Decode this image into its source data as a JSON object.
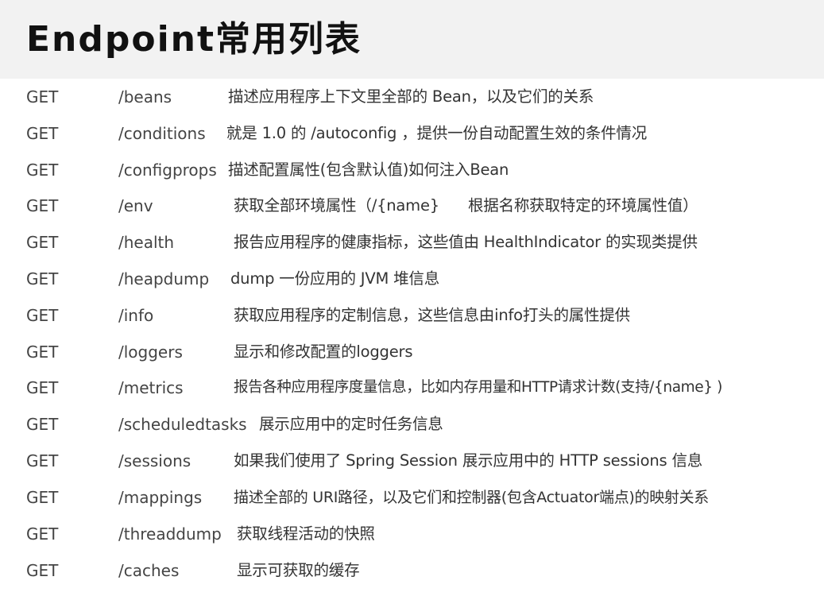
{
  "header": {
    "title": "Endpoint常用列表"
  },
  "endpoints": [
    {
      "method": "GET",
      "path": "/beans",
      "description": "描述应用程序上下文里全部的 Bean，以及它们的关系"
    },
    {
      "method": "GET",
      "path": "/conditions",
      "description": "就是 1.0 的 /autoconfig ，提供一份自动配置生效的条件情况"
    },
    {
      "method": "GET",
      "path": "/configprops",
      "description": "描述配置属性(包含默认值)如何注入Bean"
    },
    {
      "method": "GET",
      "path": "/env",
      "description": "获取全部环境属性（/{name}      根据名称获取特定的环境属性值）"
    },
    {
      "method": "GET",
      "path": "/health",
      "description": "报告应用程序的健康指标，这些值由 HealthIndicator 的实现类提供"
    },
    {
      "method": "GET",
      "path": "/heapdump",
      "description": "dump 一份应用的 JVM 堆信息"
    },
    {
      "method": "GET",
      "path": "/info",
      "description": "获取应用程序的定制信息，这些信息由info打头的属性提供"
    },
    {
      "method": "GET",
      "path": "/loggers",
      "description": "显示和修改配置的loggers"
    },
    {
      "method": "GET",
      "path": "/metrics",
      "description": "报告各种应用程序度量信息，比如内存用量和HTTP请求计数(支持/{name} )"
    },
    {
      "method": "GET",
      "path": "/scheduledtasks",
      "description": "展示应用中的定时任务信息"
    },
    {
      "method": "GET",
      "path": "/sessions",
      "description": "如果我们使用了 Spring Session 展示应用中的 HTTP sessions 信息"
    },
    {
      "method": "GET",
      "path": "/mappings",
      "description": "描述全部的 URI路径，以及它们和控制器(包含Actuator端点)的映射关系"
    },
    {
      "method": "GET",
      "path": "/threaddump",
      "description": "获取线程活动的快照"
    },
    {
      "method": "GET",
      "path": "/caches",
      "description": "显示可获取的缓存"
    }
  ],
  "colors": {
    "title_bar_background": "#f2f2f2",
    "title_text": "#111111",
    "body_text": "#333333"
  }
}
